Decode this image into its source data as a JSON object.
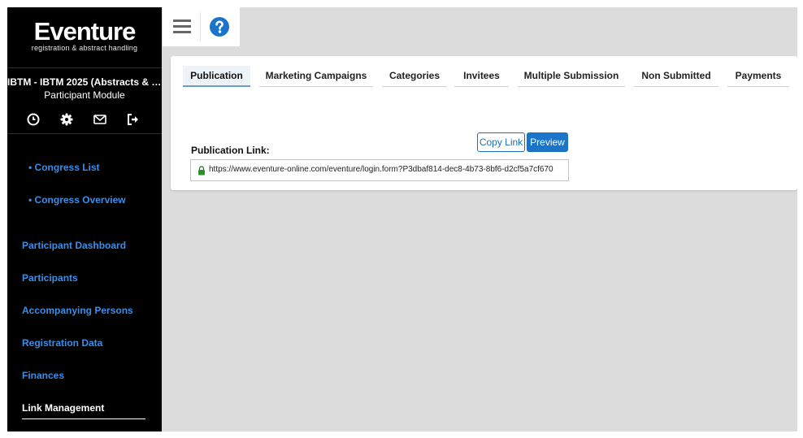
{
  "sidebar": {
    "logo_title": "Eventure",
    "logo_subtitle": "registration & abstract handling",
    "congress_title": "IBTM - IBTM 2025 (Abstracts & Par...",
    "module_label": "Participant Module",
    "icons": [
      "clock-icon",
      "gear-icon",
      "envelope-icon",
      "logout-icon"
    ],
    "sub_items": [
      "• Congress List",
      "• Congress Overview"
    ],
    "items": [
      "Participant Dashboard",
      "Participants",
      "Accompanying Persons",
      "Registration Data",
      "Finances",
      "Link Management"
    ],
    "active_item": "Link Management"
  },
  "toolbar": {
    "menu_icon": "hamburger-icon",
    "help_icon": "help-icon"
  },
  "tabs": [
    "Publication",
    "Marketing Campaigns",
    "Categories",
    "Invitees",
    "Multiple Submission",
    "Non Submitted",
    "Payments"
  ],
  "active_tab": "Publication",
  "publication": {
    "label": "Publication Link:",
    "copy_label": "Copy Link",
    "preview_label": "Preview",
    "url": "https://www.eventure-online.com/eventure/login.form?P3dbaf814-dec8-4b73-8bf6-d2cf5a7cf670"
  },
  "colors": {
    "link_blue": "#3a8ee6",
    "accent": "#1a74c9",
    "sidebar_bg": "#000000",
    "page_bg": "#dcdcdc"
  }
}
